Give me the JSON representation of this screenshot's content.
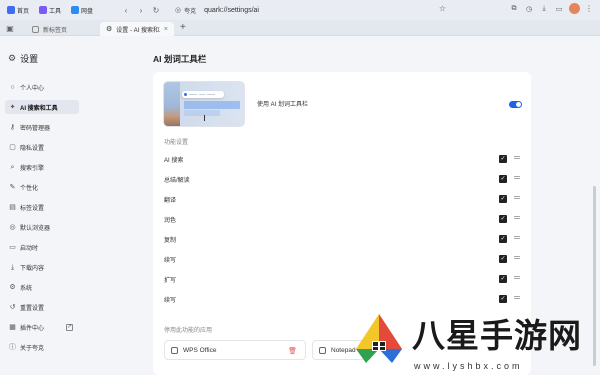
{
  "bookmarks": [
    {
      "label": "首页",
      "icon": "home-icon",
      "color": "#3d6df2"
    },
    {
      "label": "工具",
      "icon": "tools-icon",
      "color": "#7a5cf2"
    },
    {
      "label": "网盘",
      "icon": "cloud-icon",
      "color": "#2d8cf0"
    }
  ],
  "address": {
    "url": "quark://settings/ai",
    "secure_label": "夸克"
  },
  "tabs": [
    {
      "label": "新标签页"
    },
    {
      "label": "设置 - AI 搜索和工具"
    }
  ],
  "sidebar": {
    "title": "设置",
    "items": [
      {
        "label": "个人中心",
        "icon": "person-icon"
      },
      {
        "label": "AI 搜索和工具",
        "icon": "ai-icon"
      },
      {
        "label": "密码管理器",
        "icon": "key-icon"
      },
      {
        "label": "隐私设置",
        "icon": "lock-icon"
      },
      {
        "label": "搜索引擎",
        "icon": "search-icon"
      },
      {
        "label": "个性化",
        "icon": "brush-icon"
      },
      {
        "label": "标签设置",
        "icon": "tab-icon"
      },
      {
        "label": "默认浏览器",
        "icon": "browser-icon"
      },
      {
        "label": "启动时",
        "icon": "startup-icon"
      },
      {
        "label": "下载内容",
        "icon": "download-icon"
      },
      {
        "label": "系统",
        "icon": "system-icon"
      },
      {
        "label": "重置设置",
        "icon": "reset-icon"
      },
      {
        "label": "插件中心",
        "icon": "plugin-icon"
      },
      {
        "label": "关于夸克",
        "icon": "info-icon"
      }
    ],
    "active_index": 1
  },
  "page": {
    "title": "AI 划词工具栏",
    "main_toggle_label": "使用 AI 划词工具栏",
    "main_toggle_on": true,
    "features_label": "功能设置",
    "features": [
      {
        "label": "AI 搜索",
        "checked": true
      },
      {
        "label": "总结/解读",
        "checked": true
      },
      {
        "label": "翻译",
        "checked": true
      },
      {
        "label": "润色",
        "checked": true
      },
      {
        "label": "复制",
        "checked": true
      },
      {
        "label": "续写",
        "checked": true
      },
      {
        "label": "扩写",
        "checked": true
      },
      {
        "label": "续写",
        "checked": true
      }
    ],
    "disabled_apps_label": "停用此功能的应用",
    "apps": [
      {
        "label": "WPS Office"
      },
      {
        "label": "Notepad"
      }
    ]
  },
  "watermark": {
    "brand": "八星手游网",
    "domain": "www.lyshbx.com"
  },
  "colors": {
    "accent": "#1e62e8",
    "danger": "#e05858"
  }
}
